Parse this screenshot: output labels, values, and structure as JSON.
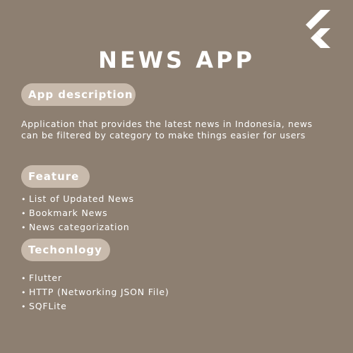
{
  "logo": {
    "icon": "flutter-logo-icon",
    "color": "#ffffff"
  },
  "title": "NEWS APP",
  "sections": {
    "description": {
      "heading": "App description",
      "lines": [
        "Application that provides the latest news in Indonesia, news",
        "can be filtered by category to make things easier for users"
      ]
    },
    "feature": {
      "heading": "Feature",
      "items": [
        "List of Updated News",
        "Bookmark News",
        "News categorization"
      ]
    },
    "technology": {
      "heading": "Techonlogy",
      "items": [
        "Flutter",
        "HTTP (Networking JSON File)",
        "SQFLite"
      ]
    }
  },
  "bullet": "•",
  "colors": {
    "background": "#8d7f71",
    "pill": "#c8baac",
    "text": "#ffffff"
  }
}
